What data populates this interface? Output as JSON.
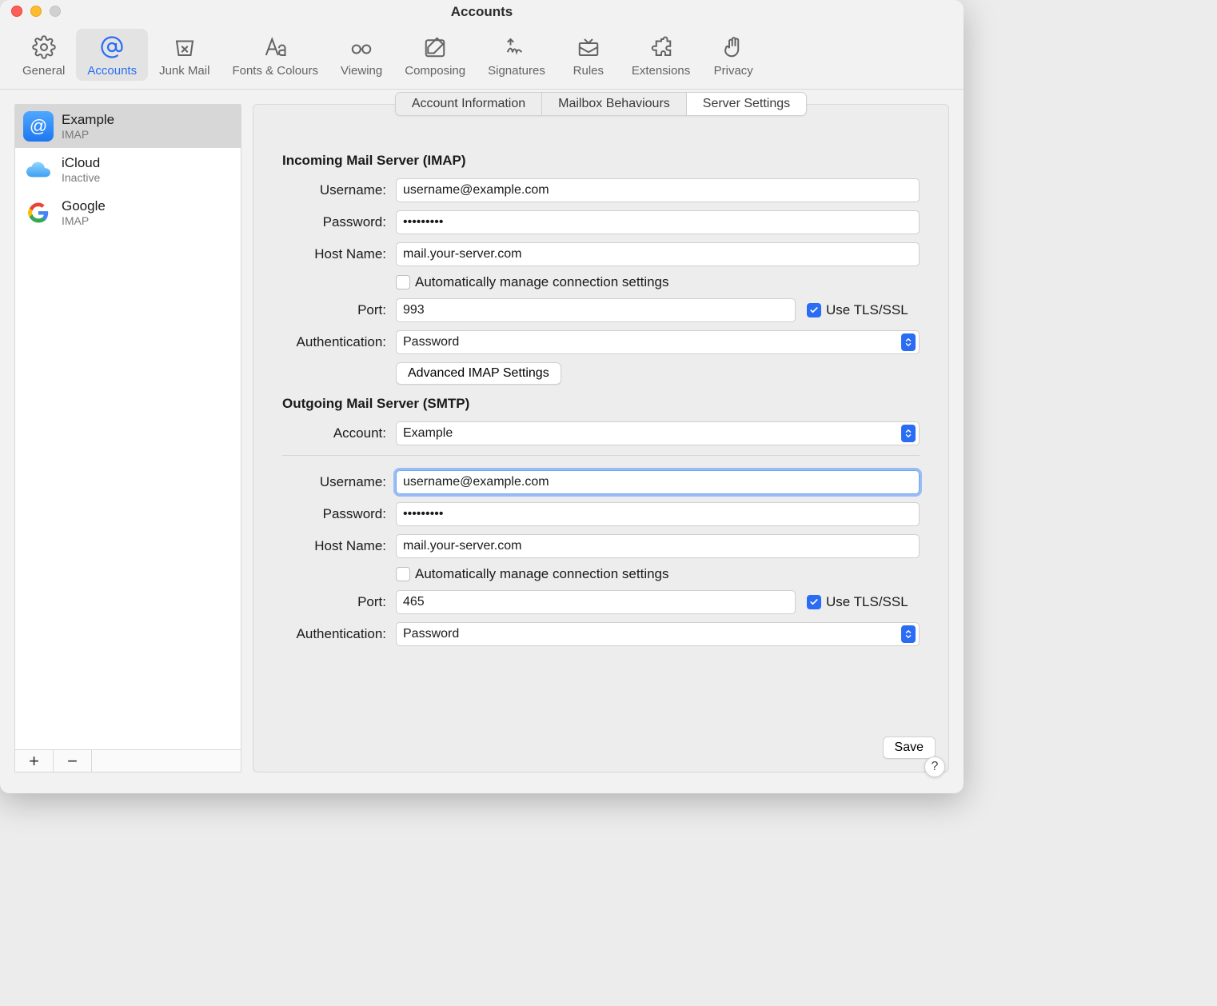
{
  "window": {
    "title": "Accounts"
  },
  "toolbar": {
    "items": [
      {
        "label": "General"
      },
      {
        "label": "Accounts"
      },
      {
        "label": "Junk Mail"
      },
      {
        "label": "Fonts & Colours"
      },
      {
        "label": "Viewing"
      },
      {
        "label": "Composing"
      },
      {
        "label": "Signatures"
      },
      {
        "label": "Rules"
      },
      {
        "label": "Extensions"
      },
      {
        "label": "Privacy"
      }
    ]
  },
  "sidebar": {
    "accounts": [
      {
        "name": "Example",
        "sub": "IMAP"
      },
      {
        "name": "iCloud",
        "sub": "Inactive"
      },
      {
        "name": "Google",
        "sub": "IMAP"
      }
    ],
    "add_symbol": "+",
    "remove_symbol": "−"
  },
  "tabs": {
    "items": [
      "Account Information",
      "Mailbox Behaviours",
      "Server Settings"
    ]
  },
  "form": {
    "incoming_title": "Incoming Mail Server (IMAP)",
    "outgoing_title": "Outgoing Mail Server (SMTP)",
    "labels": {
      "username": "Username:",
      "password": "Password:",
      "hostname": "Host Name:",
      "port": "Port:",
      "auth": "Authentication:",
      "account": "Account:"
    },
    "auto_manage": "Automatically manage connection settings",
    "use_tls": "Use TLS/SSL",
    "advanced_imap": "Advanced IMAP Settings",
    "save": "Save",
    "incoming": {
      "username": "username@example.com",
      "password": "•••••••••",
      "host": "mail.your-server.com",
      "auto_manage_checked": false,
      "port": "993",
      "tls_checked": true,
      "auth": "Password"
    },
    "outgoing": {
      "account": "Example",
      "username": "username@example.com",
      "password": "•••••••••",
      "host": "mail.your-server.com",
      "auto_manage_checked": false,
      "port": "465",
      "tls_checked": true,
      "auth": "Password"
    }
  },
  "help": "?"
}
